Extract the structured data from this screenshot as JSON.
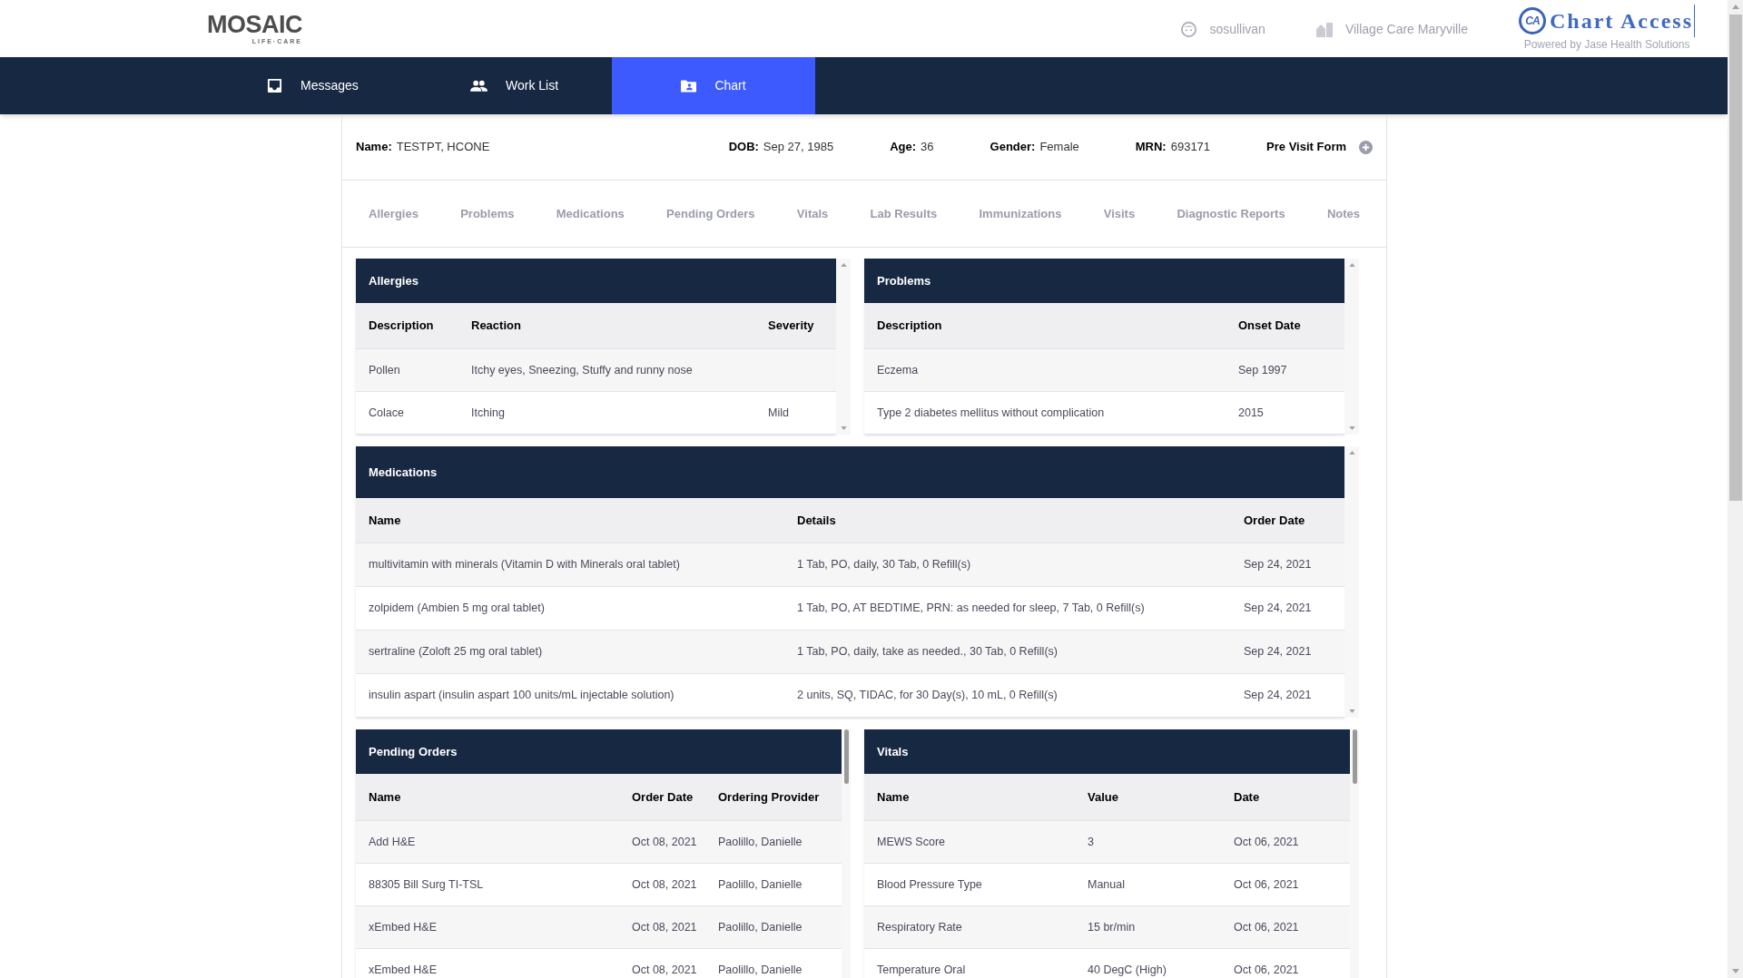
{
  "header": {
    "logo": {
      "text": "MOSAIC",
      "subtext": "LIFE·CARE"
    },
    "user": "sosullivan",
    "location": "Village Care Maryville",
    "brand": {
      "mark": "CA",
      "name": "Chart Access",
      "tagline": "Powered by Jase Health Solutions"
    }
  },
  "nav": [
    {
      "label": "Messages",
      "selected": false
    },
    {
      "label": "Work List",
      "selected": false
    },
    {
      "label": "Chart",
      "selected": true
    }
  ],
  "patient": {
    "fields": [
      {
        "label": "Name:",
        "value": "TESTPT, HCONE"
      },
      {
        "label": "DOB:",
        "value": "Sep 27, 1985"
      },
      {
        "label": "Age:",
        "value": "36"
      },
      {
        "label": "Gender:",
        "value": "Female"
      },
      {
        "label": "MRN:",
        "value": "693171"
      }
    ],
    "action": "Pre Visit Form"
  },
  "section_tabs": [
    "Allergies",
    "Problems",
    "Medications",
    "Pending Orders",
    "Vitals",
    "Lab Results",
    "Immunizations",
    "Visits",
    "Diagnostic Reports",
    "Notes"
  ],
  "panel_rows": [
    [
      {
        "title": "Allergies",
        "columns": [
          "Description",
          "Reaction",
          "Severity"
        ],
        "rows": [
          [
            "Pollen",
            "Itchy eyes, Sneezing, Stuffy and runny nose",
            ""
          ],
          [
            "Colace",
            "Itching",
            "Mild"
          ]
        ]
      },
      {
        "title": "Problems",
        "columns": [
          "Description",
          "Onset Date"
        ],
        "rows": [
          [
            "Eczema",
            "Sep 1997"
          ],
          [
            "Type 2 diabetes mellitus without complication",
            "2015"
          ]
        ]
      }
    ],
    [
      {
        "title": "Medications",
        "columns": [
          "Name",
          "Details",
          "Order Date"
        ],
        "rows": [
          [
            "multivitamin with minerals (Vitamin D with Minerals oral tablet)",
            "1 Tab, PO, daily, 30 Tab, 0 Refill(s)",
            "Sep 24, 2021"
          ],
          [
            "zolpidem (Ambien 5 mg oral tablet)",
            "1 Tab, PO, AT BEDTIME, PRN: as needed for sleep, 7 Tab, 0 Refill(s)",
            "Sep 24, 2021"
          ],
          [
            "sertraline (Zoloft 25 mg oral tablet)",
            "1 Tab, PO, daily, take as needed., 30 Tab, 0 Refill(s)",
            "Sep 24, 2021"
          ],
          [
            "insulin aspart (insulin aspart 100 units/mL injectable solution)",
            "2 units, SQ, TIDAC, for 30 Day(s), 10 mL, 0 Refill(s)",
            "Sep 24, 2021"
          ]
        ]
      }
    ],
    [
      {
        "title": "Pending Orders",
        "columns": [
          "Name",
          "Order Date",
          "Ordering Provider"
        ],
        "rows": [
          [
            "Add H&E",
            "Oct 08, 2021",
            "Paolillo, Danielle"
          ],
          [
            "88305 Bill Surg TI-TSL",
            "Oct 08, 2021",
            "Paolillo, Danielle"
          ],
          [
            "xEmbed H&E",
            "Oct 08, 2021",
            "Paolillo, Danielle"
          ],
          [
            "xEmbed H&E",
            "Oct 08, 2021",
            "Paolillo, Danielle"
          ]
        ]
      },
      {
        "title": "Vitals",
        "columns": [
          "Name",
          "Value",
          "Date"
        ],
        "rows": [
          [
            "MEWS Score",
            "3",
            "Oct 06, 2021"
          ],
          [
            "Blood Pressure Type",
            "Manual",
            "Oct 06, 2021"
          ],
          [
            "Respiratory Rate",
            "15 br/min",
            "Oct 06, 2021"
          ],
          [
            "Temperature Oral",
            "40 DegC (High)",
            "Oct 06, 2021"
          ]
        ]
      }
    ]
  ]
}
